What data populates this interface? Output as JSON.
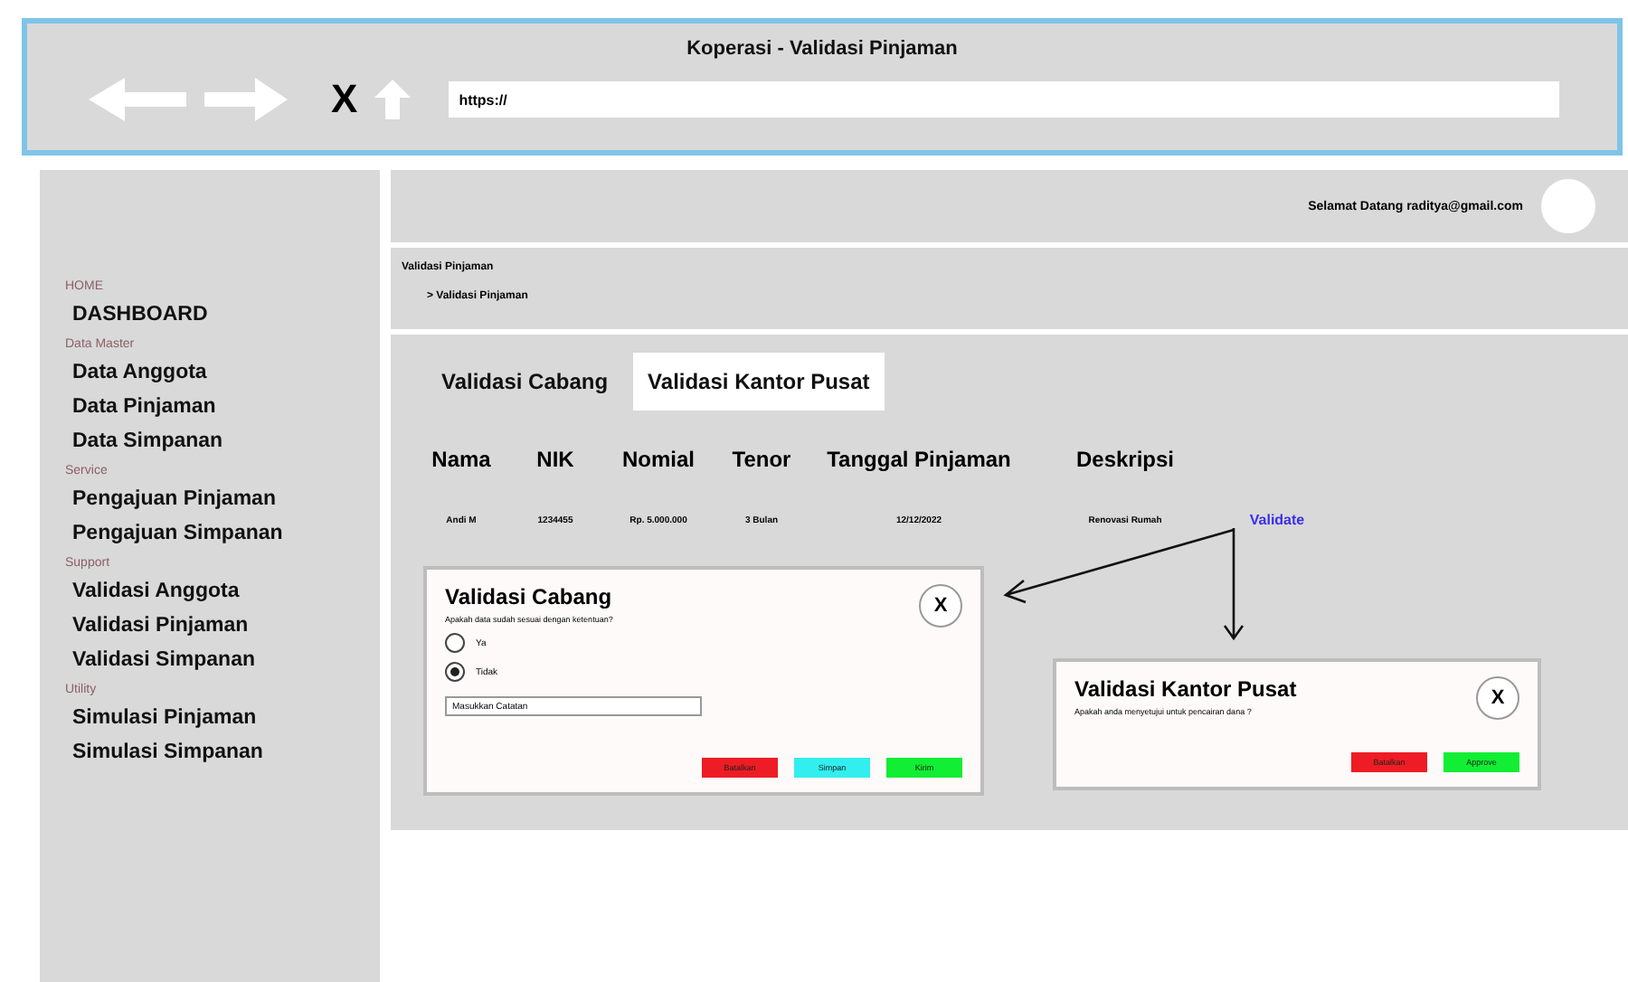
{
  "browser": {
    "title": "Koperasi - Validasi Pinjaman",
    "nav": [
      {
        "kind": "back"
      },
      {
        "kind": "forward"
      },
      {
        "kind": "close",
        "label": "X"
      },
      {
        "kind": "up"
      }
    ],
    "url": "https://"
  },
  "sidebar": {
    "sections": [
      {
        "label": "HOME",
        "items": [
          "DASHBOARD"
        ]
      },
      {
        "label": "Data Master",
        "items": [
          "Data Anggota",
          "Data Pinjaman",
          "Data Simpanan"
        ]
      },
      {
        "label": "Service",
        "items": [
          "Pengajuan Pinjaman",
          "Pengajuan Simpanan"
        ]
      },
      {
        "label": "Support",
        "items": [
          "Validasi Anggota",
          "Validasi Pinjaman",
          "Validasi Simpanan"
        ]
      },
      {
        "label": "Utility",
        "items": [
          "Simulasi Pinjaman",
          "Simulasi Simpanan"
        ]
      }
    ]
  },
  "header": {
    "greeting": "Selamat Datang raditya@gmail.com"
  },
  "breadcrumb": {
    "title": "Validasi Pinjaman",
    "item": "> Validasi Pinjaman"
  },
  "tabs": [
    {
      "label": "Validasi Cabang",
      "selected": false
    },
    {
      "label": "Validasi Kantor Pusat",
      "selected": true
    }
  ],
  "table": {
    "columns": [
      "Nama",
      "NIK",
      "Nomial",
      "Tenor",
      "Tanggal Pinjaman",
      "Deskripsi"
    ],
    "rows": [
      {
        "cells": [
          "Andi M",
          "1234455",
          "Rp. 5.000.000",
          "3 Bulan",
          "12/12/2022",
          "Renovasi Rumah"
        ],
        "action": "Validate"
      }
    ]
  },
  "dialogs": [
    {
      "title": "Validasi Cabang",
      "close": "X",
      "question": "Apakah data sudah sesuai dengan ketentuan?",
      "options": [
        {
          "label": "Ya",
          "selected": false
        },
        {
          "label": "Tidak",
          "selected": true
        }
      ],
      "note": "Masukkan Catatan",
      "buttons": [
        {
          "label": "Batalkan",
          "color": "#ee1c24"
        },
        {
          "label": "Simpan",
          "color": "#33eeee"
        },
        {
          "label": "Kirim",
          "color": "#11ee33"
        }
      ]
    },
    {
      "title": "Validasi Kantor Pusat",
      "close": "X",
      "question": "Apakah anda menyetujui untuk pencairan dana ?",
      "buttons": [
        {
          "label": "Batalkan",
          "color": "#ee1c24"
        },
        {
          "label": "Approve",
          "color": "#11ee33"
        }
      ]
    }
  ]
}
